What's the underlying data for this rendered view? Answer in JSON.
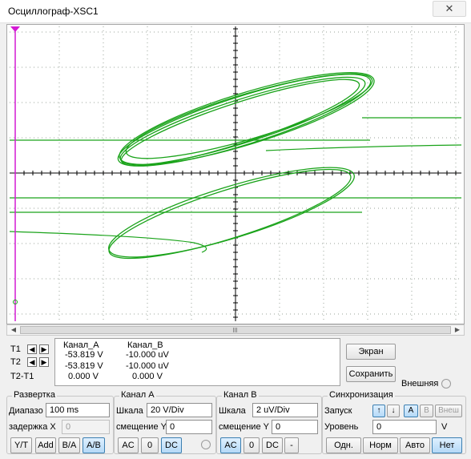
{
  "window": {
    "title": "Осциллограф-XSC1",
    "close_glyph": "✕"
  },
  "screen": {
    "colors": {
      "trace": "#1aa31a",
      "grid": "#9aa39a",
      "axis": "#000000",
      "cursor": "#d41ad4"
    }
  },
  "scrollbar": {
    "left_glyph": "◀",
    "right_glyph": "▶"
  },
  "cursors": {
    "t1_label": "T1",
    "t2_label": "T2",
    "t2t1_label": "T2-T1",
    "left_glyph": "◀",
    "right_glyph": "▶",
    "headers": {
      "channel_a": "Канал_A",
      "channel_b": "Канал_B"
    },
    "rows": [
      {
        "a": "-53.819 V",
        "b": "-10.000 uV"
      },
      {
        "a": "-53.819 V",
        "b": "-10.000 uV"
      },
      {
        "a": "0.000 V",
        "b": "0.000 V"
      }
    ]
  },
  "actions": {
    "screen_button": "Экран",
    "save_button": "Сохранить",
    "external_label": "Внешняя"
  },
  "timebase": {
    "legend": "Развертка",
    "range_label": "Диапазо",
    "range_value": "100 ms",
    "x_delay_label": "задержка X",
    "x_delay_value": "0",
    "modes": [
      "Y/T",
      "Add",
      "B/A",
      "A/B"
    ],
    "active_mode": "A/B"
  },
  "channel_a": {
    "legend": "Канал A",
    "scale_label": "Шкала",
    "scale_value": "20  V/Div",
    "offset_label": "смещение Y",
    "offset_value": "0",
    "coupling": [
      "AC",
      "0",
      "DC"
    ],
    "active_coupling": "DC"
  },
  "channel_b": {
    "legend": "Канал B",
    "scale_label": "Шкала",
    "scale_value": "2  uV/Div",
    "offset_label": "смещение Y",
    "offset_value": "0",
    "coupling": [
      "AC",
      "0",
      "DC",
      "-"
    ],
    "active_coupling": "AC"
  },
  "trigger": {
    "legend": "Синхронизация",
    "edge_label": "Запуск",
    "edge_rising": "↑",
    "edge_falling": "↓",
    "sources": [
      "A",
      "B",
      "Внеш"
    ],
    "active_source": "A",
    "level_label": "Уровень",
    "level_value": "0",
    "level_unit": "V",
    "modes": [
      "Одн.",
      "Норм",
      "Авто",
      "Нет"
    ],
    "active_mode": "Нет"
  }
}
